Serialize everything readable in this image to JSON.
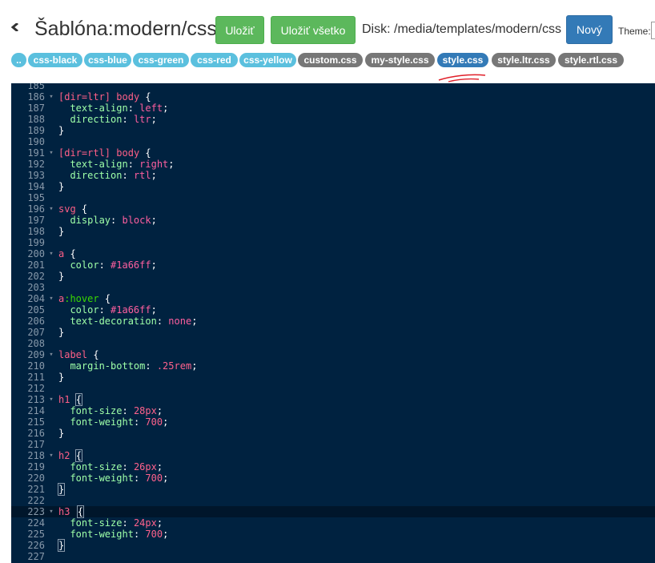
{
  "header": {
    "title": "Šablóna:modern/css",
    "save_label": "Uložiť",
    "save_all_label": "Uložiť všetko",
    "disk_path": "Disk: /media/templates/modern/css",
    "new_label": "Nový",
    "theme_label": "Theme:"
  },
  "colors": {
    "success": "#5cb85c",
    "primary": "#337ab7",
    "info": "#5bc0de",
    "default_tag": "#777777",
    "editor_bg": "#002240",
    "annotation_red": "#e0202a"
  },
  "file_tags": [
    {
      "label": "..",
      "style": "info"
    },
    {
      "label": "css-black",
      "style": "info"
    },
    {
      "label": "css-blue",
      "style": "info"
    },
    {
      "label": "css-green",
      "style": "info"
    },
    {
      "label": "css-red",
      "style": "info"
    },
    {
      "label": "css-yellow",
      "style": "info"
    },
    {
      "label": "custom.css",
      "style": "grey"
    },
    {
      "label": "my-style.css",
      "style": "grey"
    },
    {
      "label": "style.css",
      "style": "active"
    },
    {
      "label": "style.ltr.css",
      "style": "grey"
    },
    {
      "label": "style.rtl.css",
      "style": "grey"
    }
  ],
  "editor": {
    "active_line": 223,
    "lines": [
      {
        "n": 185,
        "tokens": []
      },
      {
        "n": 186,
        "fold": true,
        "tokens": [
          [
            "attr",
            "[dir=ltr]"
          ],
          [
            "punc",
            " "
          ],
          [
            "sel",
            "body"
          ],
          [
            "punc",
            " {"
          ]
        ]
      },
      {
        "n": 187,
        "tokens": [
          [
            "punc",
            "  "
          ],
          [
            "prop",
            "text-align"
          ],
          [
            "punc",
            ": "
          ],
          [
            "val",
            "left"
          ],
          [
            "punc",
            ";"
          ]
        ]
      },
      {
        "n": 188,
        "tokens": [
          [
            "punc",
            "  "
          ],
          [
            "prop",
            "direction"
          ],
          [
            "punc",
            ": "
          ],
          [
            "val",
            "ltr"
          ],
          [
            "punc",
            ";"
          ]
        ]
      },
      {
        "n": 189,
        "tokens": [
          [
            "punc",
            "}"
          ]
        ]
      },
      {
        "n": 190,
        "tokens": []
      },
      {
        "n": 191,
        "fold": true,
        "tokens": [
          [
            "attr",
            "[dir=rtl]"
          ],
          [
            "punc",
            " "
          ],
          [
            "sel",
            "body"
          ],
          [
            "punc",
            " {"
          ]
        ]
      },
      {
        "n": 192,
        "tokens": [
          [
            "punc",
            "  "
          ],
          [
            "prop",
            "text-align"
          ],
          [
            "punc",
            ": "
          ],
          [
            "val",
            "right"
          ],
          [
            "punc",
            ";"
          ]
        ]
      },
      {
        "n": 193,
        "tokens": [
          [
            "punc",
            "  "
          ],
          [
            "prop",
            "direction"
          ],
          [
            "punc",
            ": "
          ],
          [
            "val",
            "rtl"
          ],
          [
            "punc",
            ";"
          ]
        ]
      },
      {
        "n": 194,
        "tokens": [
          [
            "punc",
            "}"
          ]
        ]
      },
      {
        "n": 195,
        "tokens": []
      },
      {
        "n": 196,
        "fold": true,
        "tokens": [
          [
            "sel",
            "svg"
          ],
          [
            "punc",
            " {"
          ]
        ]
      },
      {
        "n": 197,
        "tokens": [
          [
            "punc",
            "  "
          ],
          [
            "prop",
            "display"
          ],
          [
            "punc",
            ": "
          ],
          [
            "val",
            "block"
          ],
          [
            "punc",
            ";"
          ]
        ]
      },
      {
        "n": 198,
        "tokens": [
          [
            "punc",
            "}"
          ]
        ]
      },
      {
        "n": 199,
        "tokens": []
      },
      {
        "n": 200,
        "fold": true,
        "tokens": [
          [
            "sel",
            "a"
          ],
          [
            "punc",
            " {"
          ]
        ]
      },
      {
        "n": 201,
        "tokens": [
          [
            "punc",
            "  "
          ],
          [
            "prop",
            "color"
          ],
          [
            "punc",
            ": "
          ],
          [
            "val",
            "#1a66ff"
          ],
          [
            "punc",
            ";"
          ]
        ]
      },
      {
        "n": 202,
        "tokens": [
          [
            "punc",
            "}"
          ]
        ]
      },
      {
        "n": 203,
        "tokens": []
      },
      {
        "n": 204,
        "fold": true,
        "tokens": [
          [
            "sel",
            "a"
          ],
          [
            "pseudo",
            ":hover"
          ],
          [
            "punc",
            " {"
          ]
        ]
      },
      {
        "n": 205,
        "tokens": [
          [
            "punc",
            "  "
          ],
          [
            "prop",
            "color"
          ],
          [
            "punc",
            ": "
          ],
          [
            "val",
            "#1a66ff"
          ],
          [
            "punc",
            ";"
          ]
        ]
      },
      {
        "n": 206,
        "tokens": [
          [
            "punc",
            "  "
          ],
          [
            "prop",
            "text-decoration"
          ],
          [
            "punc",
            ": "
          ],
          [
            "val",
            "none"
          ],
          [
            "punc",
            ";"
          ]
        ]
      },
      {
        "n": 207,
        "tokens": [
          [
            "punc",
            "}"
          ]
        ]
      },
      {
        "n": 208,
        "tokens": []
      },
      {
        "n": 209,
        "fold": true,
        "tokens": [
          [
            "sel",
            "label"
          ],
          [
            "punc",
            " {"
          ]
        ]
      },
      {
        "n": 210,
        "tokens": [
          [
            "punc",
            "  "
          ],
          [
            "prop",
            "margin-bottom"
          ],
          [
            "punc",
            ": "
          ],
          [
            "num",
            ".25rem"
          ],
          [
            "punc",
            ";"
          ]
        ]
      },
      {
        "n": 211,
        "tokens": [
          [
            "punc",
            "}"
          ]
        ]
      },
      {
        "n": 212,
        "tokens": []
      },
      {
        "n": 213,
        "fold": true,
        "tokens": [
          [
            "sel",
            "h1"
          ],
          [
            "punc",
            " "
          ],
          [
            "matched",
            "{"
          ]
        ]
      },
      {
        "n": 214,
        "tokens": [
          [
            "punc",
            "  "
          ],
          [
            "prop",
            "font-size"
          ],
          [
            "punc",
            ": "
          ],
          [
            "num",
            "28px"
          ],
          [
            "punc",
            ";"
          ]
        ]
      },
      {
        "n": 215,
        "tokens": [
          [
            "punc",
            "  "
          ],
          [
            "prop",
            "font-weight"
          ],
          [
            "punc",
            ": "
          ],
          [
            "num",
            "700"
          ],
          [
            "punc",
            ";"
          ]
        ]
      },
      {
        "n": 216,
        "tokens": [
          [
            "punc",
            "}"
          ]
        ]
      },
      {
        "n": 217,
        "tokens": []
      },
      {
        "n": 218,
        "fold": true,
        "tokens": [
          [
            "sel",
            "h2"
          ],
          [
            "punc",
            " "
          ],
          [
            "matched",
            "{"
          ]
        ]
      },
      {
        "n": 219,
        "tokens": [
          [
            "punc",
            "  "
          ],
          [
            "prop",
            "font-size"
          ],
          [
            "punc",
            ": "
          ],
          [
            "num",
            "26px"
          ],
          [
            "punc",
            ";"
          ]
        ]
      },
      {
        "n": 220,
        "tokens": [
          [
            "punc",
            "  "
          ],
          [
            "prop",
            "font-weight"
          ],
          [
            "punc",
            ": "
          ],
          [
            "num",
            "700"
          ],
          [
            "punc",
            ";"
          ]
        ]
      },
      {
        "n": 221,
        "tokens": [
          [
            "matched",
            "}"
          ]
        ]
      },
      {
        "n": 222,
        "tokens": []
      },
      {
        "n": 223,
        "fold": true,
        "cursor": true,
        "tokens": [
          [
            "sel",
            "h3"
          ],
          [
            "punc",
            " "
          ],
          [
            "matched",
            "{"
          ]
        ]
      },
      {
        "n": 224,
        "tokens": [
          [
            "punc",
            "  "
          ],
          [
            "prop",
            "font-size"
          ],
          [
            "punc",
            ": "
          ],
          [
            "num",
            "24px"
          ],
          [
            "punc",
            ";"
          ]
        ]
      },
      {
        "n": 225,
        "tokens": [
          [
            "punc",
            "  "
          ],
          [
            "prop",
            "font-weight"
          ],
          [
            "punc",
            ": "
          ],
          [
            "num",
            "700"
          ],
          [
            "punc",
            ";"
          ]
        ]
      },
      {
        "n": 226,
        "tokens": [
          [
            "matched",
            "}"
          ]
        ]
      },
      {
        "n": 227,
        "tokens": []
      }
    ]
  }
}
